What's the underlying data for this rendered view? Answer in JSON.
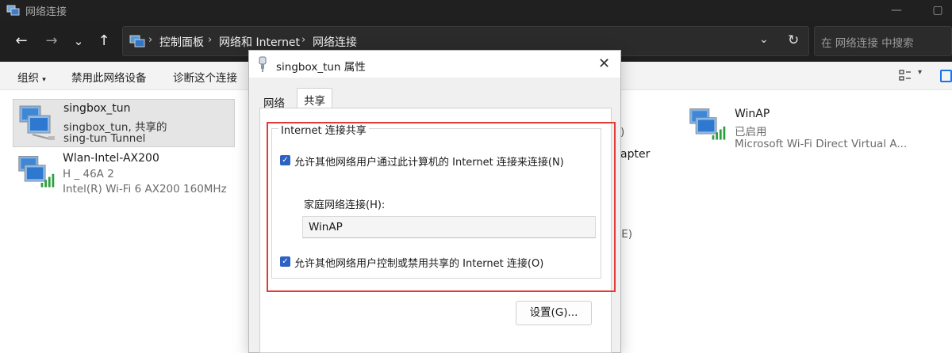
{
  "window": {
    "title": "网络连接",
    "icon": "network-connections-icon"
  },
  "nav": {
    "back": "←",
    "forward": "→",
    "recent": "⌄",
    "up": "↑",
    "breadcrumbs": [
      "控制面板",
      "网络和 Internet",
      "网络连接"
    ],
    "search_placeholder": "在 网络连接 中搜索"
  },
  "commands": [
    "组织",
    "禁用此网络设备",
    "诊断这个连接"
  ],
  "connections": [
    {
      "name": "singbox_tun",
      "status": "singbox_tun, 共享的",
      "device": "sing-tun Tunnel",
      "selected": true
    },
    {
      "name": "Wlan-Intel-AX200",
      "status": "H          _      46A 2",
      "device": "Intel(R) Wi-Fi 6 AX200 160MHz",
      "selected": false
    },
    {
      "name": "WinAP",
      "status": "已启用",
      "device": "Microsoft Wi-Fi Direct Virtual A...",
      "selected": false
    }
  ],
  "partial_text": {
    "p1": ")",
    "p2": "apter",
    "p3": ")E)"
  },
  "dialog": {
    "title": "singbox_tun 属性",
    "tabs": [
      "网络",
      "共享"
    ],
    "active_tab": "共享",
    "group_label": "Internet 连接共享",
    "allow_connect": {
      "label": "允许其他网络用户通过此计算机的 Internet 连接来连接(N)",
      "checked": true
    },
    "home_network_label": "家庭网络连接(H):",
    "home_network_value": "WinAP",
    "allow_control": {
      "label": "允许其他网络用户控制或禁用共享的 Internet 连接(O)",
      "checked": true
    },
    "settings_button": "设置(G)...",
    "close": "✕"
  },
  "colors": {
    "highlight": "#e53935",
    "checkbox": "#2c62c4",
    "signal": "#2e9e3e"
  }
}
